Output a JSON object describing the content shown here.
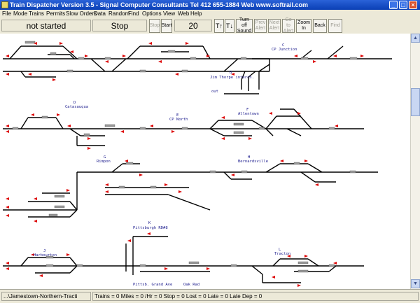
{
  "window": {
    "title": "Train Dispatcher Version 3.5 - Signal Computer Consultants Tel 412 655-1884 Web www.softrail.com"
  },
  "menu": [
    "File",
    "Mode",
    "Trains",
    "Permits",
    "Slow Orders",
    "Data",
    "Random",
    "Find",
    "Options",
    "View",
    "Web",
    "Help"
  ],
  "toolbar": {
    "status_text": "not started",
    "run_state": "Stop",
    "stop_label": "Stop",
    "start_label": "Start",
    "speed_value": "20",
    "speed_up_label": "T↑",
    "speed_down_label": "T↓",
    "turn_off_sound_label": "Turn off Sound",
    "prev_alert_label": "Prev Alert",
    "next_alert_label": "Next Alert",
    "goto_alert_label": "Go to Alert",
    "zoom_in_label": "Zoom In",
    "back_label": "Back",
    "find_label": "Find"
  },
  "stations": {
    "c": "C",
    "cp_junction": "CP Junction",
    "b": "B",
    "jim_thorpe": "Jim Thorpe interch.",
    "out": "out",
    "d": "D",
    "catasauqua": "Catasauqua",
    "e": "E",
    "cp_north": "CP North",
    "f": "F",
    "allentown": "Allentown",
    "g": "G",
    "rimpon": "Rimpon",
    "h": "H",
    "bernardsville": "Bernardsville",
    "k": "K",
    "pittsburgh": "Pittsburgh RD#8",
    "j": "J",
    "harbourton": "Harbourton",
    "l": "L",
    "tracton": "Tracton",
    "pittsb_grand": "Pittsb. Grand Ave",
    "oak_rad": "Oak Rad"
  },
  "status": {
    "file": "...\\Jamestown-Northern-Tracti",
    "stats": "Trains = 0  Miles = 0  /Hr = 0  Stop = 0  Lost = 0  Late = 0  Late Dep = 0"
  }
}
